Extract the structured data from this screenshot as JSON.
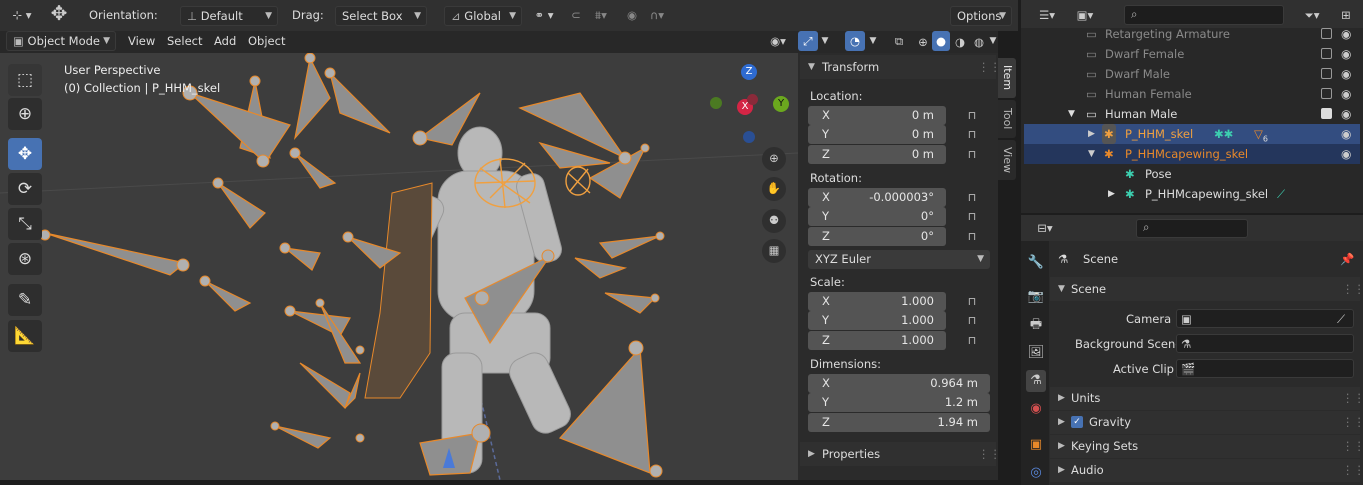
{
  "header": {
    "orientation_label": "Orientation:",
    "orientation_value": "Default",
    "drag_label": "Drag:",
    "drag_value": "Select Box",
    "transform_space": "Global",
    "options_label": "Options"
  },
  "viewport_header": {
    "mode": "Object Mode",
    "menus": [
      "View",
      "Select",
      "Add",
      "Object"
    ]
  },
  "viewport": {
    "view_name": "User Perspective",
    "collection_info": "(0) Collection | P_HHM_skel",
    "gizmo_axes": {
      "z": "Z",
      "x": "X",
      "y": "Y"
    }
  },
  "tools": [
    "select-box",
    "cursor",
    "move",
    "rotate",
    "scale",
    "transform",
    "annotate",
    "measure"
  ],
  "n_panel": {
    "tabs": [
      "Item",
      "Tool",
      "View"
    ],
    "transform_title": "Transform",
    "location_label": "Location:",
    "location": [
      {
        "axis": "X",
        "value": "0 m"
      },
      {
        "axis": "Y",
        "value": "0 m"
      },
      {
        "axis": "Z",
        "value": "0 m"
      }
    ],
    "rotation_label": "Rotation:",
    "rotation": [
      {
        "axis": "X",
        "value": "-0.000003°"
      },
      {
        "axis": "Y",
        "value": "0°"
      },
      {
        "axis": "Z",
        "value": "0°"
      }
    ],
    "rotation_mode": "XYZ Euler",
    "scale_label": "Scale:",
    "scale": [
      {
        "axis": "X",
        "value": "1.000"
      },
      {
        "axis": "Y",
        "value": "1.000"
      },
      {
        "axis": "Z",
        "value": "1.000"
      }
    ],
    "dimensions_label": "Dimensions:",
    "dimensions": [
      {
        "axis": "X",
        "value": "0.964 m"
      },
      {
        "axis": "Y",
        "value": "1.2 m"
      },
      {
        "axis": "Z",
        "value": "1.94 m"
      }
    ],
    "properties_title": "Properties"
  },
  "outliner": {
    "rows": [
      {
        "name": "Retargeting Armature"
      },
      {
        "name": "Dwarf Female"
      },
      {
        "name": "Dwarf Male"
      },
      {
        "name": "Human Female"
      },
      {
        "name": "Human Male"
      },
      {
        "name": "P_HHM_skel",
        "badge": "6"
      },
      {
        "name": "P_HHMcapewing_skel"
      },
      {
        "name": "Pose"
      },
      {
        "name": "P_HHMcapewing_skel"
      }
    ]
  },
  "properties": {
    "context_name": "Scene",
    "section_title": "Scene",
    "camera_label": "Camera",
    "background_scene_label": "Background Scene",
    "active_clip_label": "Active Clip",
    "collapsed_sections": [
      "Units",
      "Gravity",
      "Keying Sets",
      "Audio"
    ]
  },
  "colors": {
    "accent": "#4772b3",
    "selection_orange": "#e8892a",
    "active_row": "#334d80"
  }
}
